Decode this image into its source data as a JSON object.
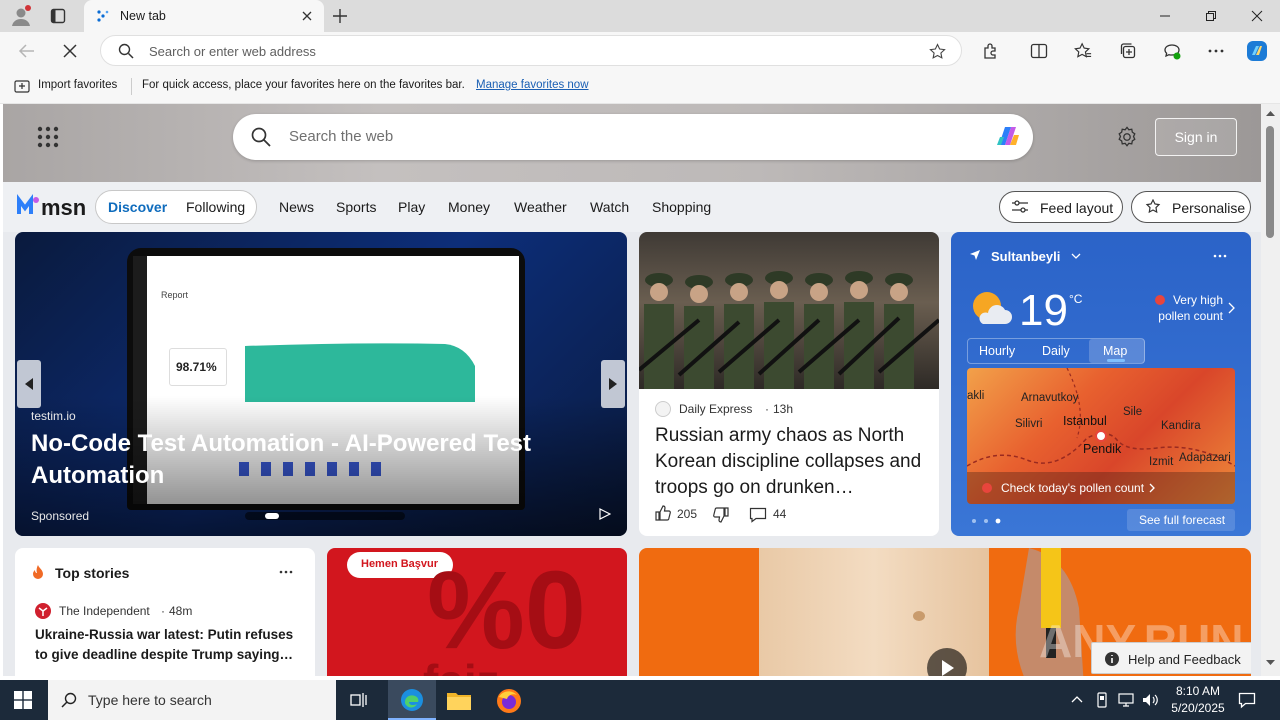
{
  "browser": {
    "tab_title": "New tab",
    "address_placeholder": "Search or enter web address",
    "favorites": {
      "import_label": "Import favorites",
      "hint": "For quick access, place your favorites here on the favorites bar.",
      "manage_link": "Manage favorites now"
    }
  },
  "msn": {
    "search_placeholder": "Search the web",
    "signin_label": "Sign in",
    "logo_text": "msn",
    "tabs": [
      "Discover",
      "Following"
    ],
    "nav": [
      "News",
      "Sports",
      "Play",
      "Money",
      "Weather",
      "Watch",
      "Shopping"
    ],
    "feed_layout_label": "Feed layout",
    "personalise_label": "Personalise",
    "ad": {
      "source": "testim.io",
      "title": "No-Code Test Automation - AI-Powered Test Automation",
      "sponsored": "Sponsored",
      "screen_report": "Report",
      "screen_value": "98.71%"
    },
    "story": {
      "source": "Daily Express",
      "age": "13h",
      "headline": "Russian army chaos as North Korean discipline collapses and troops go on drunken…",
      "likes": "205",
      "comments": "44"
    },
    "weather": {
      "location": "Sultanbeyli",
      "temp": "19",
      "unit": "°C",
      "alert": "Very high pollen count",
      "tabs": [
        "Hourly",
        "Daily",
        "Map"
      ],
      "map_labels": [
        "Arnavutkoy",
        "Silivri",
        "Istanbul",
        "Sile",
        "Kandira",
        "Pendik",
        "Izmit",
        "Adapazari",
        "akli"
      ],
      "pollen_link": "Check today's pollen count",
      "forecast_link": "See full forecast"
    },
    "top_stories": {
      "title": "Top stories",
      "source": "The Independent",
      "age": "48m",
      "headline": "Ukraine-Russia war latest: Putin refuses to give deadline despite Trump saying…"
    },
    "promo": {
      "badge": "Hemen Başvur",
      "big_text": "%0",
      "sub_text": "faiz"
    },
    "video": {
      "watermark": "ANY.RUN",
      "help_label": "Help and Feedback"
    }
  },
  "taskbar": {
    "search_placeholder": "Type here to search",
    "time": "8:10 AM",
    "date": "5/20/2025"
  }
}
